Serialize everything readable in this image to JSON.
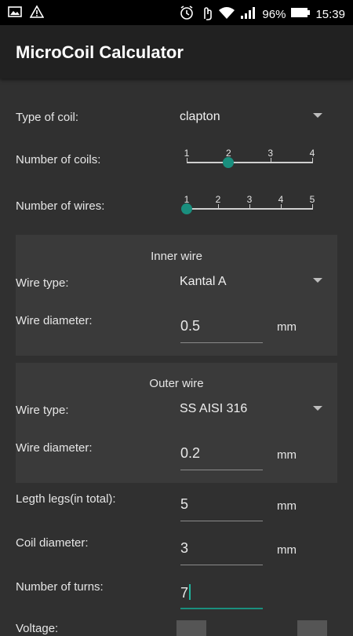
{
  "status_bar": {
    "battery": "96%",
    "time": "15:39",
    "icons": [
      "image-icon",
      "warning-icon",
      "alarm-icon",
      "touch-icon",
      "wifi-icon",
      "signal-icon",
      "battery-icon"
    ]
  },
  "app": {
    "title": "MicroCoil Calculator"
  },
  "form": {
    "type_of_coil": {
      "label": "Type of coil:",
      "value": "clapton"
    },
    "number_of_coils": {
      "label": "Number of coils:",
      "ticks": [
        "1",
        "2",
        "3",
        "4"
      ],
      "value": 2
    },
    "number_of_wires": {
      "label": "Number of wires:",
      "ticks": [
        "1",
        "2",
        "3",
        "4",
        "5"
      ],
      "value": 1
    },
    "inner_wire": {
      "title": "Inner wire",
      "type_label": "Wire type:",
      "type_value": "Kantal A",
      "diameter_label": "Wire diameter:",
      "diameter_value": "0.5",
      "unit": "mm"
    },
    "outer_wire": {
      "title": "Outer wire",
      "type_label": "Wire type:",
      "type_value": "SS AISI 316",
      "diameter_label": "Wire diameter:",
      "diameter_value": "0.2",
      "unit": "mm"
    },
    "legs_length": {
      "label": "Legth legs(in total):",
      "value": "5",
      "unit": "mm"
    },
    "coil_diameter": {
      "label": "Coil diameter:",
      "value": "3",
      "unit": "mm"
    },
    "number_of_turns": {
      "label": "Number of turns:",
      "value": "7"
    },
    "voltage": {
      "label": "Voltage:"
    }
  },
  "colors": {
    "accent": "#1a8f7e",
    "background": "#303030",
    "app_bar": "#212121",
    "panel": "#3a3a3a"
  }
}
